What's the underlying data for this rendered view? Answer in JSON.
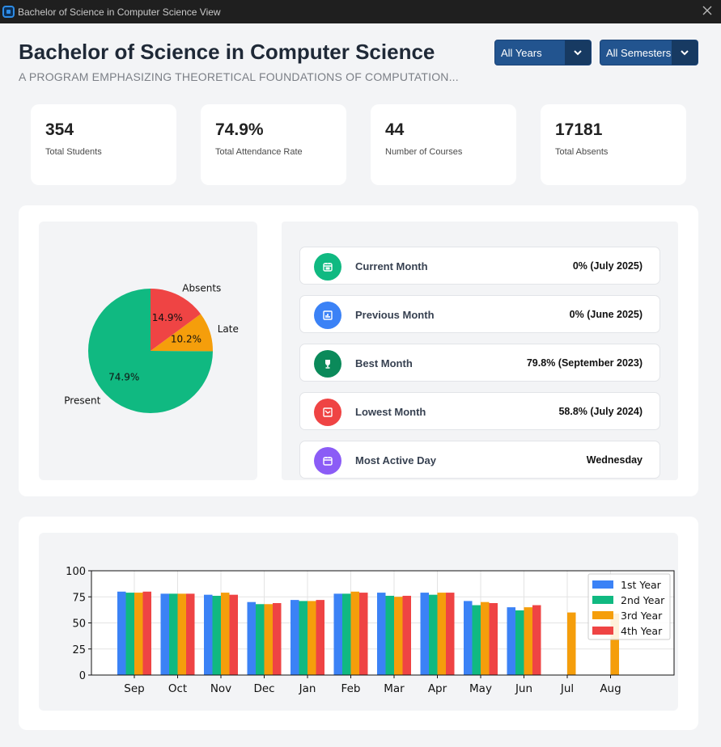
{
  "window": {
    "title": "Bachelor of Science in Computer Science View"
  },
  "header": {
    "title": "Bachelor of Science in Computer Science",
    "subtitle": "A PROGRAM EMPHASIZING THEORETICAL FOUNDATIONS OF COMPUTATION..."
  },
  "filters": {
    "years": "All Years",
    "semesters": "All Semesters"
  },
  "stats": [
    {
      "value": "354",
      "label": "Total Students"
    },
    {
      "value": "74.9%",
      "label": "Total Attendance Rate"
    },
    {
      "value": "44",
      "label": "Number of Courses"
    },
    {
      "value": "17181",
      "label": "Total Absents"
    }
  ],
  "metrics": [
    {
      "label": "Current Month",
      "value": "0% (July 2025)",
      "icon": "calendar-icon",
      "color": "#10b981"
    },
    {
      "label": "Previous Month",
      "value": "0% (June 2025)",
      "icon": "bar-chart-icon",
      "color": "#3b82f6"
    },
    {
      "label": "Best Month",
      "value": "79.8% (September 2023)",
      "icon": "trophy-icon",
      "color": "#0b8a5a"
    },
    {
      "label": "Lowest Month",
      "value": "58.8% (July 2024)",
      "icon": "trend-down-icon",
      "color": "#ef4444"
    },
    {
      "label": "Most Active Day",
      "value": "Wednesday",
      "icon": "calendar-day-icon",
      "color": "#8b5cf6"
    }
  ],
  "chart_data": [
    {
      "type": "pie",
      "slices": [
        {
          "label": "Present",
          "value": 74.9,
          "pct_label": "74.9%",
          "color": "#10b981"
        },
        {
          "label": "Late",
          "value": 10.2,
          "pct_label": "10.2%",
          "color": "#f59e0b"
        },
        {
          "label": "Absents",
          "value": 14.9,
          "pct_label": "14.9%",
          "color": "#ef4444"
        }
      ]
    },
    {
      "type": "bar",
      "categories": [
        "Sep",
        "Oct",
        "Nov",
        "Dec",
        "Jan",
        "Feb",
        "Mar",
        "Apr",
        "May",
        "Jun",
        "Jul",
        "Aug"
      ],
      "ylim": [
        0,
        100
      ],
      "yticks": [
        0,
        25,
        50,
        75,
        100
      ],
      "grid": true,
      "legend": "top-right",
      "series": [
        {
          "name": "1st Year",
          "color": "#3b82f6",
          "values": [
            80,
            78,
            77,
            70,
            72,
            78,
            79,
            79,
            71,
            65,
            null,
            null
          ]
        },
        {
          "name": "2nd Year",
          "color": "#10b981",
          "values": [
            79,
            78,
            76,
            68,
            71,
            78,
            76,
            77,
            67,
            62,
            null,
            null
          ]
        },
        {
          "name": "3rd Year",
          "color": "#f59e0b",
          "values": [
            79,
            78,
            79,
            68,
            71,
            80,
            75,
            79,
            70,
            65,
            60,
            59
          ]
        },
        {
          "name": "4th Year",
          "color": "#ef4444",
          "values": [
            80,
            78,
            77,
            69,
            72,
            79,
            76,
            79,
            69,
            67,
            null,
            null
          ]
        }
      ]
    }
  ]
}
